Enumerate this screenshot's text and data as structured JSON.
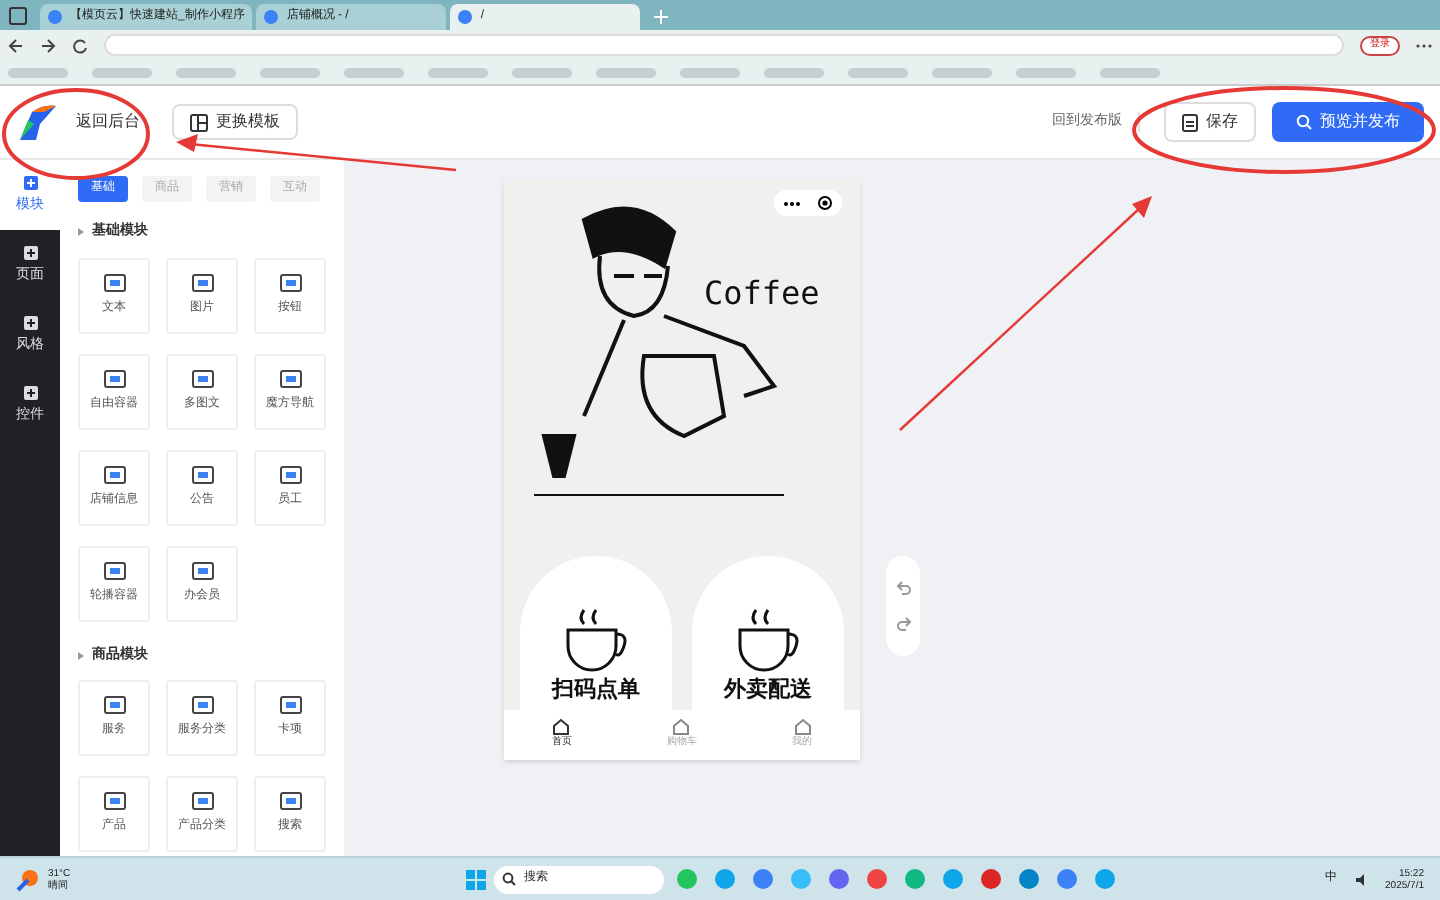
{
  "browser": {
    "tabs": [
      {
        "title": "【模页云】快速建站_制作小程序",
        "selected": false
      },
      {
        "title": "店铺概况 - /",
        "selected": false
      },
      {
        "title": "/",
        "selected": true
      }
    ],
    "account_button": "登录"
  },
  "header": {
    "back_label": "返回后台",
    "template_button": "更换模板",
    "revert_link": "回到发布版",
    "save_button": "保存",
    "publish_button": "预览并发布"
  },
  "rail": [
    {
      "label": "模块",
      "selected": true
    },
    {
      "label": "页面",
      "selected": false
    },
    {
      "label": "风格",
      "selected": false
    },
    {
      "label": "控件",
      "selected": false
    }
  ],
  "panel_tabs": [
    {
      "label": "基础",
      "selected": true
    },
    {
      "label": "商品",
      "selected": false
    },
    {
      "label": "营销",
      "selected": false
    },
    {
      "label": "互动",
      "selected": false
    }
  ],
  "sections": [
    {
      "title": "基础模块",
      "items": [
        "文本",
        "图片",
        "按钮",
        "自由容器",
        "多图文",
        "魔方导航",
        "店铺信息",
        "公告",
        "员工",
        "轮播容器",
        "办会员"
      ]
    },
    {
      "title": "商品模块",
      "items": [
        "服务",
        "服务分类",
        "卡项",
        "产品",
        "产品分类",
        "搜索"
      ]
    }
  ],
  "phone": {
    "banner_text": "Coffee",
    "cards": [
      "扫码点单",
      "外卖配送"
    ],
    "nav": [
      {
        "label": "首页",
        "selected": true
      },
      {
        "label": "购物车",
        "selected": false
      },
      {
        "label": "我的",
        "selected": false
      }
    ]
  },
  "taskbar": {
    "weather_temp": "31°C",
    "weather_text": "晴间",
    "search": "搜索",
    "ime": "中",
    "time": "15:22",
    "date": "2025/7/1"
  }
}
